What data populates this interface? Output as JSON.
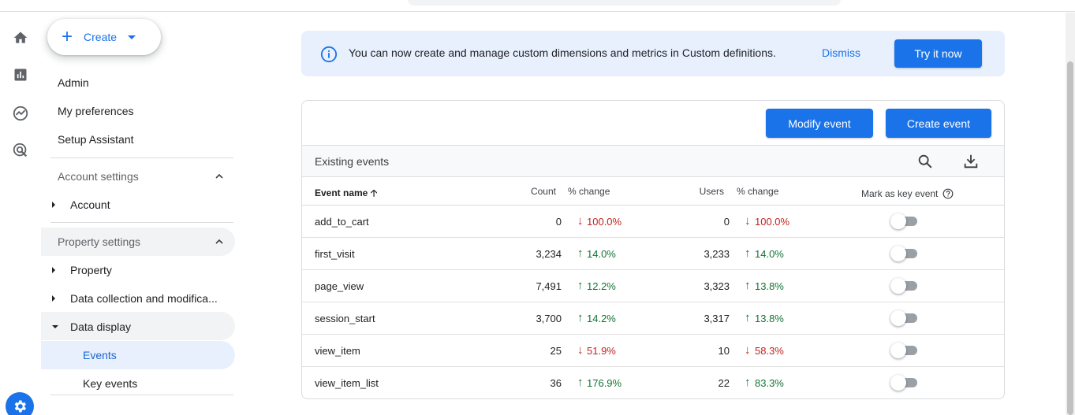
{
  "nav": {
    "create_label": "Create",
    "items_top": [
      "Admin",
      "My preferences",
      "Setup Assistant"
    ],
    "account_settings": {
      "label": "Account settings",
      "children": [
        "Account"
      ]
    },
    "property_settings": {
      "label": "Property settings",
      "children": [
        "Property",
        "Data collection and modifica...",
        "Data display"
      ]
    },
    "data_display_children": [
      "Events",
      "Key events"
    ]
  },
  "rail_icons": [
    "home-icon",
    "reports-icon",
    "explore-icon",
    "advertising-icon",
    "settings-icon"
  ],
  "banner": {
    "message": "You can now create and manage custom dimensions and metrics in Custom definitions.",
    "dismiss": "Dismiss",
    "try_it": "Try it now"
  },
  "events_card": {
    "modify_event": "Modify event",
    "create_event": "Create event",
    "title": "Existing events",
    "columns": {
      "event_name": "Event name",
      "count": "Count",
      "count_change": "% change",
      "users": "Users",
      "users_change": "% change",
      "mark_key": "Mark as key event"
    },
    "rows": [
      {
        "name": "add_to_cart",
        "count": "0",
        "count_change": "100.0%",
        "count_dir": "down",
        "users": "0",
        "users_change": "100.0%",
        "users_dir": "down",
        "key_event": false
      },
      {
        "name": "first_visit",
        "count": "3,234",
        "count_change": "14.0%",
        "count_dir": "up",
        "users": "3,233",
        "users_change": "14.0%",
        "users_dir": "up",
        "key_event": false
      },
      {
        "name": "page_view",
        "count": "7,491",
        "count_change": "12.2%",
        "count_dir": "up",
        "users": "3,323",
        "users_change": "13.8%",
        "users_dir": "up",
        "key_event": false
      },
      {
        "name": "session_start",
        "count": "3,700",
        "count_change": "14.2%",
        "count_dir": "up",
        "users": "3,317",
        "users_change": "13.8%",
        "users_dir": "up",
        "key_event": false
      },
      {
        "name": "view_item",
        "count": "25",
        "count_change": "51.9%",
        "count_dir": "down",
        "users": "10",
        "users_change": "58.3%",
        "users_dir": "down",
        "key_event": false
      },
      {
        "name": "view_item_list",
        "count": "36",
        "count_change": "176.9%",
        "count_dir": "up",
        "users": "22",
        "users_change": "83.3%",
        "users_dir": "up",
        "key_event": false
      }
    ]
  },
  "colors": {
    "accent": "#1a73e8",
    "up": "#137333",
    "down": "#c5221f",
    "banner_bg": "#e8f0fe",
    "active_nav": "#e8f0fe"
  }
}
